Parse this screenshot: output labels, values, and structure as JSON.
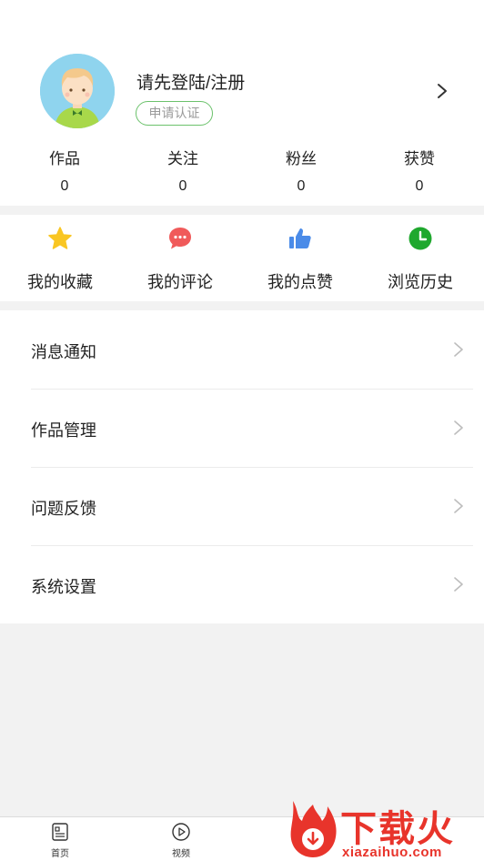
{
  "profile": {
    "login_prompt": "请先登陆/注册",
    "certification_label": "申请认证"
  },
  "stats": [
    {
      "label": "作品",
      "value": "0"
    },
    {
      "label": "关注",
      "value": "0"
    },
    {
      "label": "粉丝",
      "value": "0"
    },
    {
      "label": "获赞",
      "value": "0"
    }
  ],
  "shortcuts": [
    {
      "label": "我的收藏",
      "icon": "star-icon",
      "color": "#f9c623"
    },
    {
      "label": "我的评论",
      "icon": "comment-icon",
      "color": "#f05a5a"
    },
    {
      "label": "我的点赞",
      "icon": "thumbs-up-icon",
      "color": "#4a8be8"
    },
    {
      "label": "浏览历史",
      "icon": "clock-icon",
      "color": "#1fa82e"
    }
  ],
  "menu": [
    {
      "label": "消息通知"
    },
    {
      "label": "作品管理"
    },
    {
      "label": "问题反馈"
    },
    {
      "label": "系统设置"
    }
  ],
  "tabbar": [
    {
      "label": "首页",
      "icon": "document-icon"
    },
    {
      "label": "视频",
      "icon": "play-icon"
    }
  ],
  "watermark": {
    "brand": "下载火",
    "url": "xiazaihuo.com"
  }
}
